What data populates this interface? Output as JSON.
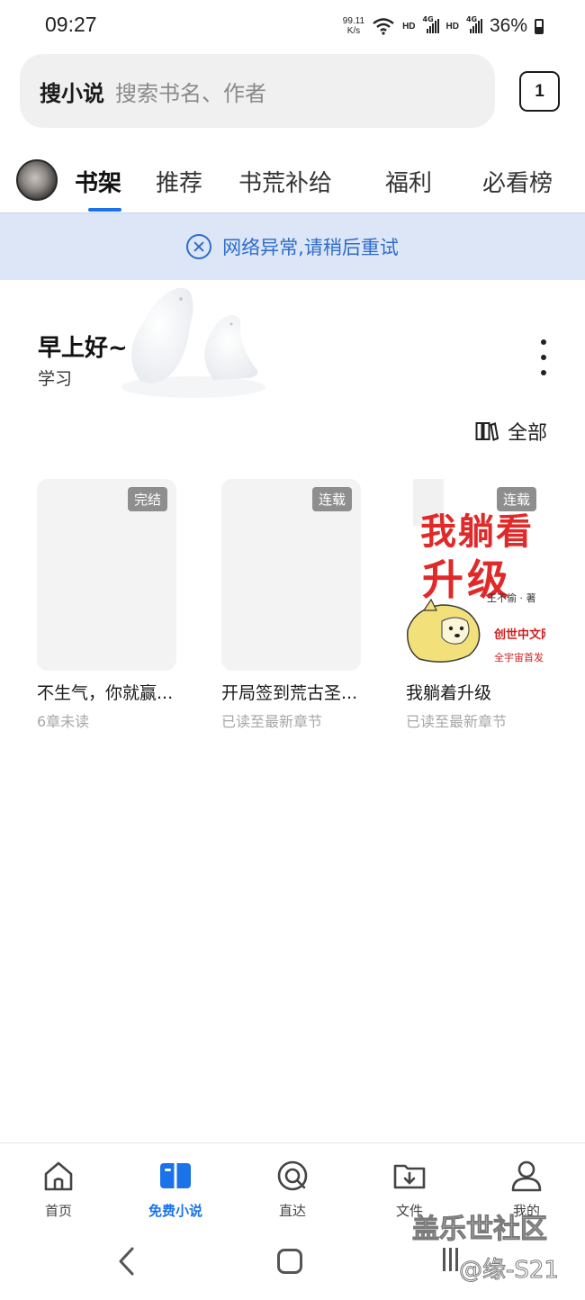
{
  "status_bar": {
    "time": "09:27",
    "net_speed_value": "99.11",
    "net_speed_unit": "K/s",
    "hd_label": "HD",
    "signal_label": "4G",
    "battery": "36%"
  },
  "search": {
    "brand": "搜小说",
    "placeholder": "搜索书名、作者"
  },
  "tab_count": "1",
  "top_tabs": [
    {
      "label": "书架",
      "active": true
    },
    {
      "label": "推荐",
      "active": false
    },
    {
      "label": "书荒补给",
      "active": false
    },
    {
      "label": "福利",
      "active": false
    },
    {
      "label": "必看榜",
      "active": false
    }
  ],
  "error_banner": {
    "text": "网络异常,请稍后重试"
  },
  "greeting": {
    "title": "早上好~",
    "subtitle": "学习"
  },
  "filter": {
    "label": "全部",
    "icon": "bookshelf-icon"
  },
  "books": [
    {
      "title": "不生气，你就赢...",
      "status": "6章未读",
      "badge": "完结"
    },
    {
      "title": "开局签到荒古圣...",
      "status": "已读至最新章节",
      "badge": "连载"
    },
    {
      "title": "我躺着升级",
      "status": "已读至最新章节",
      "badge": "连载"
    }
  ],
  "cover_art": {
    "title_top": "我躺看",
    "title_bottom": "升级",
    "author": "王不偷 · 著",
    "publisher": "创世中文网",
    "slogan": "全宇宙首发"
  },
  "bottom_nav": [
    {
      "label": "首页",
      "icon": "home-icon",
      "active": false
    },
    {
      "label": "免费小说",
      "icon": "open-book-icon",
      "active": true
    },
    {
      "label": "直达",
      "icon": "search-target-icon",
      "active": false
    },
    {
      "label": "文件",
      "icon": "folder-download-icon",
      "active": false
    },
    {
      "label": "我的",
      "icon": "person-icon",
      "active": false
    }
  ],
  "watermark": {
    "line1": "盖乐世社区",
    "line2": "@缘-S21"
  },
  "colors": {
    "accent": "#1a73e8",
    "banner_bg": "#dce6f7",
    "banner_text": "#2f6cc9",
    "badge_bg": "#8e8e8e",
    "cover_red": "#e02a2a"
  }
}
